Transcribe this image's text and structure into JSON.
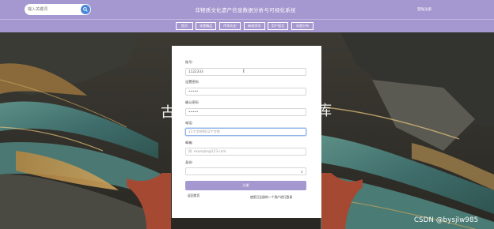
{
  "header": {
    "search_placeholder": "输入关键词",
    "site_title": "非物质文化遗产信息数据分析与可视化系统",
    "login_link": "登陆注册"
  },
  "nav": {
    "items": [
      {
        "label": "首页"
      },
      {
        "label": "非遗精品"
      },
      {
        "label": "传承历史"
      },
      {
        "label": "新闻资讯"
      },
      {
        "label": "用户留言"
      },
      {
        "label": "非遗分布"
      }
    ]
  },
  "background": {
    "text_left": "古",
    "text_right": "库"
  },
  "form": {
    "account_label": "账号:",
    "account_value": "1122333",
    "password_label": "设置密码",
    "password_value": "•••••",
    "confirm_label": "确认密码",
    "confirm_value": "•••••",
    "phone_label": "电话:",
    "phone_placeholder": "11个字符到12个字符",
    "email_label": "邮箱:",
    "email_placeholder": "例: example@123.com",
    "identity_label": "身份:",
    "identity_value": "",
    "submit_label": "注册",
    "back_link": "返回首页",
    "login_link": "使用已注册的一个用户进行登录"
  },
  "watermark": "CSDN @bysjlw985",
  "icons": {
    "search": "search-icon",
    "cursor": "text-cursor-icon",
    "select": "chevron-updown-icon"
  }
}
